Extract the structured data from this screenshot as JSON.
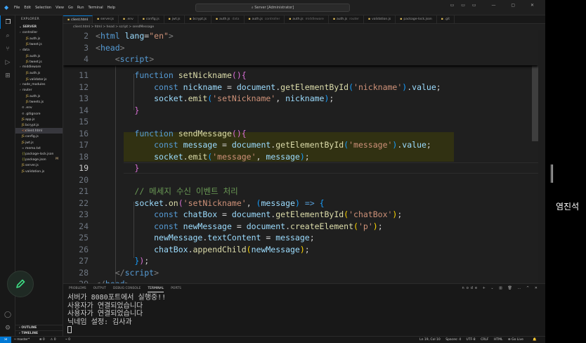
{
  "titlebar": {
    "menu": [
      "File",
      "Edit",
      "Selection",
      "View",
      "Go",
      "Run",
      "Terminal",
      "Help"
    ],
    "command_center": "Server [Administrator]"
  },
  "activity_bar": {
    "top": [
      "files-icon",
      "search-icon",
      "source-control-icon",
      "run-debug-icon",
      "extensions-icon"
    ],
    "bottom": [
      "account-icon",
      "settings-icon"
    ]
  },
  "explorer": {
    "header": "EXPLORER",
    "section": "SERVER",
    "items": [
      {
        "label": "controller",
        "type": "folder",
        "depth": 1
      },
      {
        "label": "auth.js",
        "type": "js",
        "depth": 2
      },
      {
        "label": "tweet.js",
        "type": "js",
        "depth": 2
      },
      {
        "label": "data",
        "type": "folder",
        "depth": 1
      },
      {
        "label": "auth.js",
        "type": "js",
        "depth": 2
      },
      {
        "label": "tweet.js",
        "type": "js",
        "depth": 2
      },
      {
        "label": "middleware",
        "type": "folder",
        "depth": 1
      },
      {
        "label": "auth.js",
        "type": "js",
        "depth": 2
      },
      {
        "label": "validator.js",
        "type": "js",
        "depth": 2
      },
      {
        "label": "node_modules",
        "type": "folder",
        "depth": 1
      },
      {
        "label": "router",
        "type": "folder",
        "depth": 1
      },
      {
        "label": "auth.js",
        "type": "js",
        "depth": 2
      },
      {
        "label": "tweets.js",
        "type": "js",
        "depth": 2
      },
      {
        "label": ".env",
        "type": "cfg",
        "depth": 1
      },
      {
        "label": ".gitignore",
        "type": "cfg",
        "depth": 1
      },
      {
        "label": "app.js",
        "type": "js",
        "depth": 1
      },
      {
        "label": "bcrypt.js",
        "type": "js",
        "depth": 1
      },
      {
        "label": "client.html",
        "type": "html",
        "depth": 1,
        "selected": true
      },
      {
        "label": "config.js",
        "type": "js",
        "depth": 1
      },
      {
        "label": "jwt.js",
        "type": "js",
        "depth": 1
      },
      {
        "label": "memo.txt",
        "type": "txt",
        "depth": 1
      },
      {
        "label": "package-lock.json",
        "type": "json",
        "depth": 1
      },
      {
        "label": "package.json",
        "type": "json",
        "depth": 1,
        "badge": "M"
      },
      {
        "label": "server.js",
        "type": "js",
        "depth": 1
      },
      {
        "label": "validation.js",
        "type": "js",
        "depth": 1
      }
    ],
    "outline": "OUTLINE",
    "timeline": "TIMELINE"
  },
  "tabs": [
    {
      "label": "client.html",
      "desc": "",
      "active": true
    },
    {
      "label": "server.js",
      "desc": ""
    },
    {
      "label": ".env",
      "desc": ""
    },
    {
      "label": "config.js",
      "desc": ""
    },
    {
      "label": "jwt.js",
      "desc": ""
    },
    {
      "label": "bcrypt.js",
      "desc": ""
    },
    {
      "label": "auth.js",
      "desc": "data"
    },
    {
      "label": "auth.js",
      "desc": "controller"
    },
    {
      "label": "auth.js",
      "desc": "middleware"
    },
    {
      "label": "auth.js",
      "desc": "router"
    },
    {
      "label": "validation.js",
      "desc": ""
    },
    {
      "label": "package-lock.json",
      "desc": ""
    },
    {
      "label": ".git",
      "desc": ""
    }
  ],
  "breadcrumb": "client.html > html > head > script > sendMessage",
  "editor": {
    "current_line": 19,
    "sticky": [
      {
        "n": 2,
        "parts": [
          [
            "punct",
            "<"
          ],
          [
            "tag",
            "html"
          ],
          [
            "txt",
            " "
          ],
          [
            "attr",
            "lang"
          ],
          [
            "txt",
            "="
          ],
          [
            "str",
            "\"en\""
          ],
          [
            "punct",
            ">"
          ]
        ]
      },
      {
        "n": 3,
        "parts": [
          [
            "punct",
            "<"
          ],
          [
            "tag",
            "head"
          ],
          [
            "punct",
            ">"
          ]
        ]
      },
      {
        "n": 4,
        "parts": [
          [
            "txt",
            "    "
          ],
          [
            "punct",
            "<"
          ],
          [
            "tag",
            "script"
          ],
          [
            "punct",
            ">"
          ]
        ]
      }
    ],
    "lines": [
      {
        "n": 11,
        "parts": [
          [
            "txt",
            "        "
          ],
          [
            "kw",
            "function"
          ],
          [
            "txt",
            " "
          ],
          [
            "fn",
            "setNickname"
          ],
          [
            "br2",
            "()"
          ],
          [
            "br2",
            "{"
          ]
        ]
      },
      {
        "n": 12,
        "parts": [
          [
            "txt",
            "            "
          ],
          [
            "kw",
            "const"
          ],
          [
            "txt",
            " "
          ],
          [
            "var",
            "nickname"
          ],
          [
            "txt",
            " = "
          ],
          [
            "var",
            "document"
          ],
          [
            "txt",
            "."
          ],
          [
            "fn",
            "getElementById"
          ],
          [
            "br3",
            "("
          ],
          [
            "str",
            "'nickname'"
          ],
          [
            "br3",
            ")"
          ],
          [
            "txt",
            "."
          ],
          [
            "var",
            "value"
          ],
          [
            "txt",
            ";"
          ]
        ]
      },
      {
        "n": 13,
        "parts": [
          [
            "txt",
            "            "
          ],
          [
            "var",
            "socket"
          ],
          [
            "txt",
            "."
          ],
          [
            "fn",
            "emit"
          ],
          [
            "br3",
            "("
          ],
          [
            "str",
            "'setNickname'"
          ],
          [
            "txt",
            ", "
          ],
          [
            "var",
            "nickname"
          ],
          [
            "br3",
            ")"
          ],
          [
            "txt",
            ";"
          ]
        ]
      },
      {
        "n": 14,
        "parts": [
          [
            "txt",
            "        "
          ],
          [
            "br2",
            "}"
          ]
        ]
      },
      {
        "n": 15,
        "parts": []
      },
      {
        "n": 16,
        "parts": [
          [
            "txt",
            "        "
          ],
          [
            "kw",
            "function"
          ],
          [
            "txt",
            " "
          ],
          [
            "fn",
            "sendMessage"
          ],
          [
            "br2",
            "()"
          ],
          [
            "br2",
            "{"
          ]
        ]
      },
      {
        "n": 17,
        "parts": [
          [
            "txt",
            "            "
          ],
          [
            "kw",
            "const"
          ],
          [
            "txt",
            " "
          ],
          [
            "var",
            "message"
          ],
          [
            "txt",
            " = "
          ],
          [
            "var",
            "document"
          ],
          [
            "txt",
            "."
          ],
          [
            "fn",
            "getElementById"
          ],
          [
            "br3",
            "("
          ],
          [
            "str",
            "'message'"
          ],
          [
            "br3",
            ")"
          ],
          [
            "txt",
            "."
          ],
          [
            "var",
            "value"
          ],
          [
            "txt",
            ";"
          ]
        ]
      },
      {
        "n": 18,
        "parts": [
          [
            "txt",
            "            "
          ],
          [
            "var",
            "socket"
          ],
          [
            "txt",
            "."
          ],
          [
            "fn",
            "emit"
          ],
          [
            "br3",
            "("
          ],
          [
            "str",
            "'message'"
          ],
          [
            "txt",
            ", "
          ],
          [
            "var",
            "message"
          ],
          [
            "br3",
            ")"
          ],
          [
            "txt",
            ";"
          ]
        ]
      },
      {
        "n": 19,
        "parts": [
          [
            "txt",
            "        "
          ],
          [
            "br2",
            "}"
          ]
        ]
      },
      {
        "n": 20,
        "parts": []
      },
      {
        "n": 21,
        "parts": [
          [
            "txt",
            "        "
          ],
          [
            "cm",
            "// 메세지 수신 이벤트 처리"
          ]
        ]
      },
      {
        "n": 22,
        "parts": [
          [
            "txt",
            "        "
          ],
          [
            "var",
            "socket"
          ],
          [
            "txt",
            "."
          ],
          [
            "fn",
            "on"
          ],
          [
            "br2",
            "("
          ],
          [
            "str",
            "'setNickname'"
          ],
          [
            "txt",
            ", "
          ],
          [
            "br3",
            "("
          ],
          [
            "var",
            "message"
          ],
          [
            "br3",
            ")"
          ],
          [
            "txt",
            " "
          ],
          [
            "kw",
            "=>"
          ],
          [
            "txt",
            " "
          ],
          [
            "br3",
            "{"
          ]
        ]
      },
      {
        "n": 23,
        "parts": [
          [
            "txt",
            "            "
          ],
          [
            "kw",
            "const"
          ],
          [
            "txt",
            " "
          ],
          [
            "var",
            "chatBox"
          ],
          [
            "txt",
            " = "
          ],
          [
            "var",
            "document"
          ],
          [
            "txt",
            "."
          ],
          [
            "fn",
            "getElementById"
          ],
          [
            "br",
            "("
          ],
          [
            "str",
            "'chatBox'"
          ],
          [
            "br",
            ")"
          ],
          [
            "txt",
            ";"
          ]
        ]
      },
      {
        "n": 24,
        "parts": [
          [
            "txt",
            "            "
          ],
          [
            "kw",
            "const"
          ],
          [
            "txt",
            " "
          ],
          [
            "var",
            "newMessage"
          ],
          [
            "txt",
            " = "
          ],
          [
            "var",
            "document"
          ],
          [
            "txt",
            "."
          ],
          [
            "fn",
            "createElement"
          ],
          [
            "br",
            "("
          ],
          [
            "str",
            "'p'"
          ],
          [
            "br",
            ")"
          ],
          [
            "txt",
            ";"
          ]
        ]
      },
      {
        "n": 25,
        "parts": [
          [
            "txt",
            "            "
          ],
          [
            "var",
            "newMessage"
          ],
          [
            "txt",
            "."
          ],
          [
            "var",
            "textContent"
          ],
          [
            "txt",
            " = "
          ],
          [
            "var",
            "message"
          ],
          [
            "txt",
            ";"
          ]
        ]
      },
      {
        "n": 26,
        "parts": [
          [
            "txt",
            "            "
          ],
          [
            "var",
            "chatBox"
          ],
          [
            "txt",
            "."
          ],
          [
            "fn",
            "appendChild"
          ],
          [
            "br",
            "("
          ],
          [
            "var",
            "newMessage"
          ],
          [
            "br",
            ")"
          ],
          [
            "txt",
            ";"
          ]
        ]
      },
      {
        "n": 27,
        "parts": [
          [
            "txt",
            "        "
          ],
          [
            "br3",
            "}"
          ],
          [
            "br2",
            ")"
          ],
          [
            "txt",
            ";"
          ]
        ]
      },
      {
        "n": 28,
        "parts": [
          [
            "txt",
            "    "
          ],
          [
            "punct",
            "</"
          ],
          [
            "tag",
            "script"
          ],
          [
            "punct",
            ">"
          ]
        ]
      },
      {
        "n": 29,
        "parts": [
          [
            "punct",
            "</"
          ],
          [
            "tag",
            "head"
          ],
          [
            "punct",
            ">"
          ]
        ]
      }
    ]
  },
  "panel": {
    "tabs": [
      "PROBLEMS",
      "OUTPUT",
      "DEBUG CONSOLE",
      "TERMINAL",
      "PORTS"
    ],
    "active_tab": "TERMINAL",
    "terminal_name": "node",
    "terminal_lines": [
      "서버가 8080포트에서 실행중!!",
      "사용자가 연결되었습니다",
      "사용자가 연결되었습니다",
      "닉네임 설정: 김사과"
    ]
  },
  "statusbar": {
    "branch": "master*",
    "errors": "0",
    "warnings": "0",
    "ports": "0",
    "position": "Ln 19, Col 10",
    "spaces": "Spaces: 4",
    "encoding": "UTF-8",
    "eol": "CRLF",
    "language": "HTML",
    "golive": "Go Live"
  },
  "overlay": {
    "user_label": "염진석"
  },
  "colors": {
    "accent": "#0078d4",
    "editor_bg": "#1f1f1f",
    "sidebar_bg": "#181818"
  }
}
